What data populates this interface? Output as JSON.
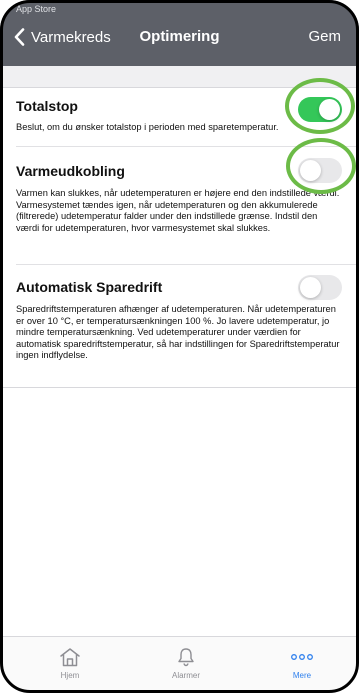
{
  "status": {
    "app_label": "App Store"
  },
  "nav": {
    "back_label": "Varmekreds",
    "title": "Optimering",
    "save_label": "Gem"
  },
  "settings": [
    {
      "title": "Totalstop",
      "enabled": true,
      "description": "Beslut, om du ønsker totalstop i perioden med sparetemperatur."
    },
    {
      "title": "Varmeudkobling",
      "enabled": false,
      "description": "Varmen kan slukkes, når udetemperaturen er højere end den indstillede værdi. Varmesystemet tændes igen, når udetemperaturen og den akkumulerede (filtrerede) udetemperatur falder under den indstillede grænse. Indstil den værdi for udetemperaturen, hvor varmesystemet skal slukkes."
    },
    {
      "title": "Automatisk Sparedrift",
      "enabled": false,
      "description": "Sparedriftstemperaturen afhænger af udetemperaturen. Når udetemperaturen er over 10 °C, er temperatursænkningen 100 %. Jo lavere udetemperatur, jo mindre temperatursænkning. Ved udetemperaturer under værdien for automatisk sparedriftstemperatur, så har indstillingen for Sparedriftstemperatur ingen indflydelse."
    }
  ],
  "tabs": [
    {
      "label": "Hjem",
      "icon": "home-icon",
      "active": false
    },
    {
      "label": "Alarmer",
      "icon": "bell-icon",
      "active": false
    },
    {
      "label": "Mere",
      "icon": "more-icon",
      "active": true
    }
  ],
  "colors": {
    "nav_bg": "#5d6068",
    "toggle_on": "#34c759",
    "highlight": "#6cbb47",
    "tab_active": "#2f80ed"
  }
}
